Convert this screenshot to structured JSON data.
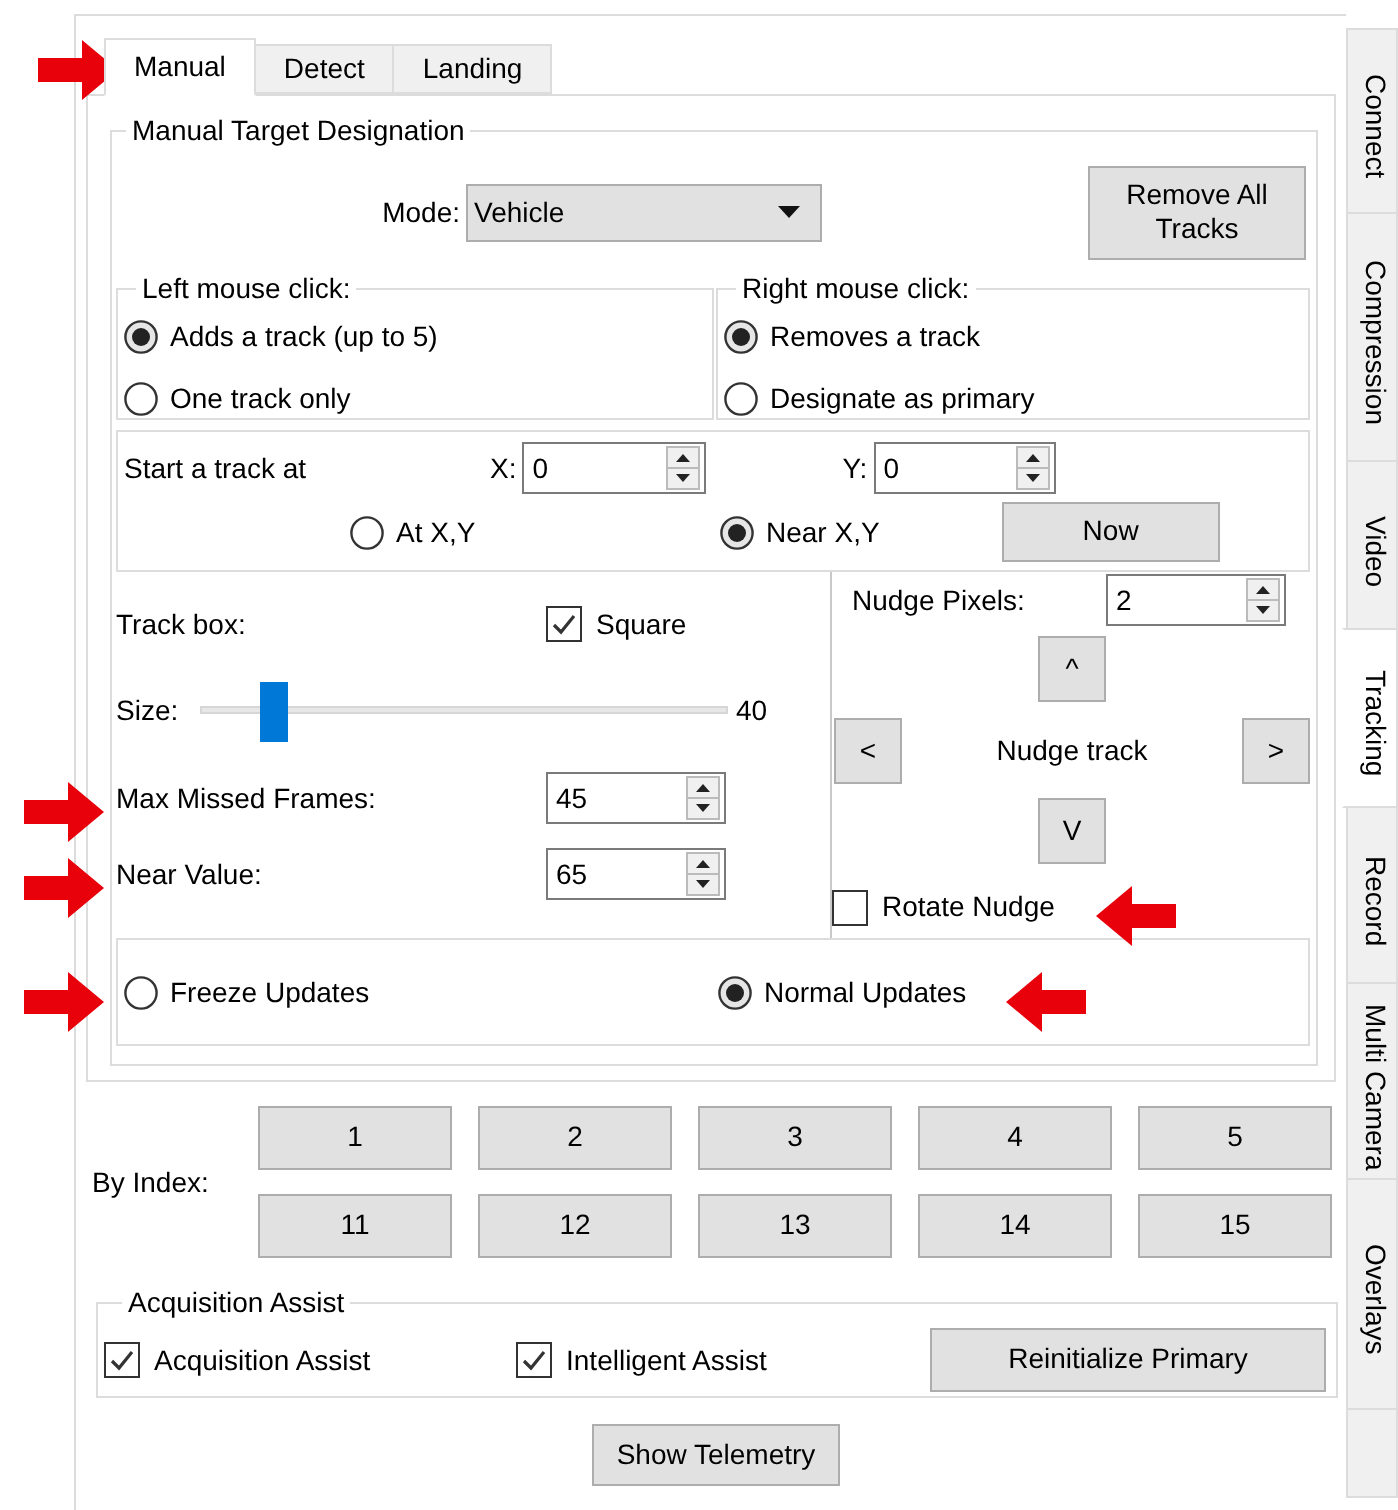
{
  "tabs": [
    {
      "label": "Manual",
      "selected": true
    },
    {
      "label": "Detect",
      "selected": false
    },
    {
      "label": "Landing",
      "selected": false
    }
  ],
  "side_tabs": [
    {
      "label": "Connect",
      "selected": false
    },
    {
      "label": "Compression",
      "selected": false
    },
    {
      "label": "Video",
      "selected": false
    },
    {
      "label": "Tracking",
      "selected": true
    },
    {
      "label": "Record",
      "selected": false
    },
    {
      "label": "Multi Camera",
      "selected": false
    },
    {
      "label": "Overlays",
      "selected": false
    }
  ],
  "designation": {
    "title": "Manual Target Designation",
    "mode": {
      "label": "Mode:",
      "value": "Vehicle"
    },
    "remove_button": "Remove All Tracks",
    "left_click": {
      "title": "Left mouse click:",
      "options": [
        {
          "label": "Adds a track (up to 5)",
          "selected": true
        },
        {
          "label": "One track only",
          "selected": false
        }
      ]
    },
    "right_click": {
      "title": "Right mouse click:",
      "options": [
        {
          "label": "Removes a track",
          "selected": true
        },
        {
          "label": "Designate as primary",
          "selected": false
        }
      ]
    },
    "start": {
      "label": "Start a track at",
      "x": {
        "label": "X:",
        "value": "0"
      },
      "y": {
        "label": "Y:",
        "value": "0"
      },
      "options": [
        {
          "label": "At X,Y",
          "selected": false
        },
        {
          "label": "Near X,Y",
          "selected": true
        }
      ],
      "now_button": "Now"
    },
    "track_box": {
      "label": "Track box:",
      "square": {
        "label": "Square",
        "checked": true
      }
    },
    "size": {
      "label": "Size:",
      "level": 0.14,
      "reading": "40"
    },
    "max_missed": {
      "label": "Max Missed Frames:",
      "value": "45"
    },
    "near_value": {
      "label": "Near Value:",
      "value": "65"
    },
    "nudge": {
      "pixels_label": "Nudge Pixels:",
      "pixels": "2",
      "up": "^",
      "left": "<",
      "label": "Nudge track",
      "right": ">",
      "down": "V",
      "rotate": {
        "label": "Rotate Nudge",
        "checked": false
      }
    },
    "updates": [
      {
        "label": "Freeze Updates",
        "selected": false
      },
      {
        "label": "Normal Updates",
        "selected": true
      }
    ]
  },
  "by_index": {
    "label": "By Index:",
    "buttons": [
      "1",
      "2",
      "3",
      "4",
      "5",
      "11",
      "12",
      "13",
      "14",
      "15"
    ]
  },
  "acquisition": {
    "title": "Acquisition Assist",
    "checks": [
      {
        "label": "Acquisition Assist",
        "checked": true
      },
      {
        "label": "Intelligent Assist",
        "checked": true
      }
    ],
    "button": "Reinitialize Primary"
  },
  "telemetry_button": "Show Telemetry"
}
